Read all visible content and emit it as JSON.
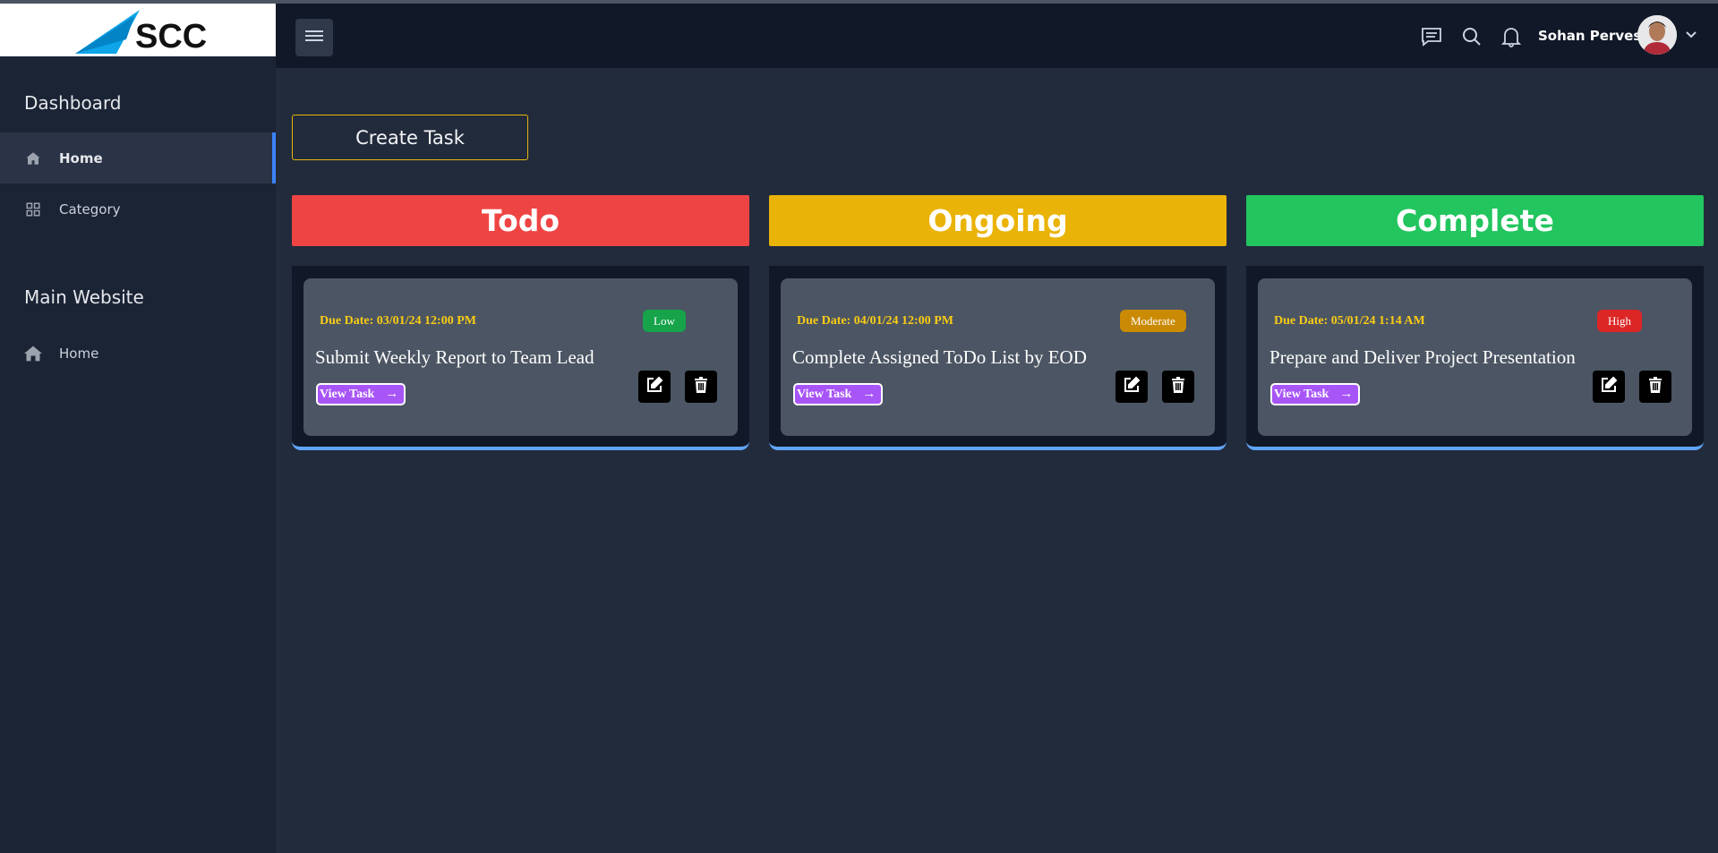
{
  "brand": {
    "logo_text": "SCC"
  },
  "sidebar": {
    "sections": [
      {
        "title": "Dashboard"
      },
      {
        "title": "Main Website"
      }
    ],
    "items": [
      {
        "label": "Home",
        "icon": "home-icon",
        "active": true
      },
      {
        "label": "Category",
        "icon": "grid-icon",
        "active": false
      },
      {
        "label": "Home",
        "icon": "house-icon",
        "active": false
      }
    ]
  },
  "header": {
    "user_name": "Sohan Perves",
    "icons": [
      "chat-icon",
      "search-icon",
      "bell-icon",
      "chevron-down-icon"
    ]
  },
  "main": {
    "create_label": "Create Task",
    "columns": [
      {
        "title": "Todo",
        "color": "#ef4444",
        "card": {
          "due": "Due Date: 03/01/24 12:00 PM",
          "priority": "Low",
          "priority_color": "#16a34a",
          "title": "Submit Weekly Report to Team Lead",
          "view_label": "View Task"
        }
      },
      {
        "title": "Ongoing",
        "color": "#eab308",
        "card": {
          "due": "Due Date: 04/01/24 12:00 PM",
          "priority": "Moderate",
          "priority_color": "#ca8a04",
          "title": "Complete Assigned ToDo List by EOD",
          "view_label": "View Task"
        }
      },
      {
        "title": "Complete",
        "color": "#22c55e",
        "card": {
          "due": "Due Date: 05/01/24 1:14 AM",
          "priority": "High",
          "priority_color": "#dc2626",
          "title": "Prepare and Deliver Project Presentation",
          "view_label": "View Task"
        }
      }
    ]
  }
}
